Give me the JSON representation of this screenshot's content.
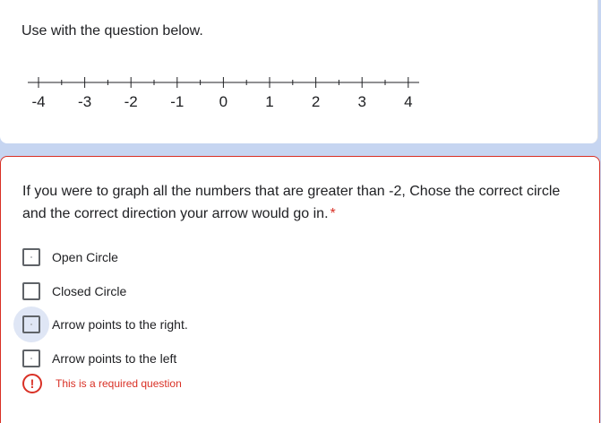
{
  "context_card": {
    "instruction": "Use with the question below.",
    "number_line_ticks": [
      "-4",
      "-3",
      "-2",
      "-1",
      "0",
      "1",
      "2",
      "3",
      "4"
    ]
  },
  "question_card": {
    "question": "If you were to graph all the numbers that are greater than -2, Chose the correct circle and the correct direction your arrow would go in.",
    "required_marker": "*",
    "options": [
      {
        "label": "Open Circle",
        "checked": false
      },
      {
        "label": "Closed Circle",
        "checked": false
      },
      {
        "label": "Arrow points to the right.",
        "checked": false,
        "hovered": true
      },
      {
        "label": "Arrow points to the left",
        "checked": false
      }
    ],
    "error_icon": "exclamation-circle-icon",
    "error_text": "This is a required question"
  },
  "colors": {
    "page_background": "#c6d5f1",
    "error": "#d93025",
    "text": "#202124",
    "checkbox_border": "#5f6368"
  }
}
